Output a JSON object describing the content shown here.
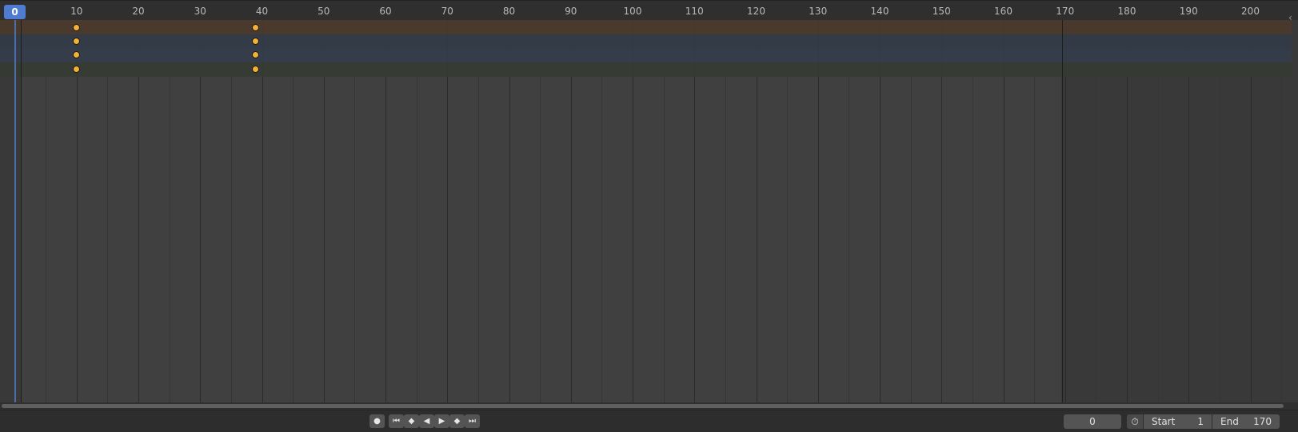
{
  "ruler": {
    "playhead_frame": "0",
    "ticks": [
      "10",
      "20",
      "30",
      "40",
      "50",
      "60",
      "70",
      "80",
      "90",
      "100",
      "110",
      "120",
      "130",
      "140",
      "150",
      "160",
      "170",
      "180",
      "190",
      "200"
    ]
  },
  "channel_colors": [
    "#4b3a2d",
    "#323b46",
    "#333d4a",
    "#353c33"
  ],
  "keyframes": {
    "frames": [
      10,
      39
    ],
    "rows": 4,
    "color": "#f2b233"
  },
  "footer": {
    "current_frame": "0",
    "start_label": "Start",
    "start_value": "1",
    "end_label": "End",
    "end_value": "170"
  },
  "icons": {
    "record": "●",
    "jump_start": "⏮",
    "prev_key": "◆",
    "play_reverse": "◀",
    "play": "▶",
    "next_key": "◆",
    "jump_end": "⏭",
    "stopwatch": "⏱",
    "collapse": "‹"
  }
}
